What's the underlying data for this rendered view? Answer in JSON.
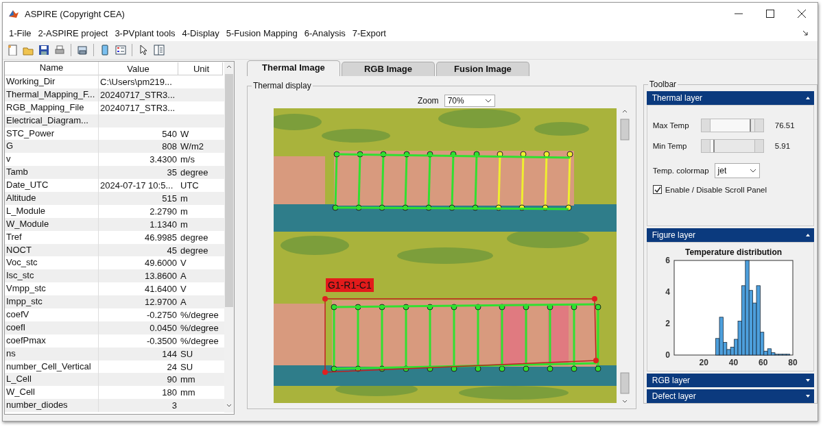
{
  "window": {
    "title": "ASPIRE (Copyright CEA)"
  },
  "menu": [
    "1-File",
    "2-ASPIRE project",
    "3-PVplant tools",
    "4-Display",
    "5-Fusion Mapping",
    "6-Analysis",
    "7-Export"
  ],
  "table": {
    "columns": [
      "Name",
      "Value",
      "Unit"
    ],
    "rows": [
      {
        "name": "Working_Dir",
        "value": "C:\\Users\\pm219...",
        "unit": "",
        "kind": "text"
      },
      {
        "name": "Thermal_Mapping_F...",
        "value": "20240717_STR3...",
        "unit": "",
        "kind": "text"
      },
      {
        "name": "RGB_Mapping_File",
        "value": "20240717_STR3...",
        "unit": "",
        "kind": "text"
      },
      {
        "name": "Electrical_Diagram...",
        "value": "",
        "unit": "",
        "kind": "text"
      },
      {
        "name": "STC_Power",
        "value": "540",
        "unit": "W",
        "kind": "number"
      },
      {
        "name": "G",
        "value": "808",
        "unit": "W/m2",
        "kind": "number"
      },
      {
        "name": "v",
        "value": "3.4300",
        "unit": "m/s",
        "kind": "number"
      },
      {
        "name": "Tamb",
        "value": "35",
        "unit": "degree",
        "kind": "number"
      },
      {
        "name": "Date_UTC",
        "value": "2024-07-17 10:5...",
        "unit": "UTC",
        "kind": "text"
      },
      {
        "name": "Altitude",
        "value": "515",
        "unit": "m",
        "kind": "number"
      },
      {
        "name": "L_Module",
        "value": "2.2790",
        "unit": "m",
        "kind": "number"
      },
      {
        "name": "W_Module",
        "value": "1.1340",
        "unit": "m",
        "kind": "number"
      },
      {
        "name": "Tref",
        "value": "46.9985",
        "unit": "degree",
        "kind": "number"
      },
      {
        "name": "NOCT",
        "value": "45",
        "unit": "degree",
        "kind": "number"
      },
      {
        "name": "Voc_stc",
        "value": "49.6000",
        "unit": "V",
        "kind": "number"
      },
      {
        "name": "Isc_stc",
        "value": "13.8600",
        "unit": "A",
        "kind": "number"
      },
      {
        "name": "Vmpp_stc",
        "value": "41.6400",
        "unit": "V",
        "kind": "number"
      },
      {
        "name": "Impp_stc",
        "value": "12.9700",
        "unit": "A",
        "kind": "number"
      },
      {
        "name": "coefV",
        "value": "-0.2750",
        "unit": "%/degree",
        "kind": "number"
      },
      {
        "name": "coefI",
        "value": "0.0450",
        "unit": "%/degree",
        "kind": "number"
      },
      {
        "name": "coefPmax",
        "value": "-0.3500",
        "unit": "%/degree",
        "kind": "number"
      },
      {
        "name": "ns",
        "value": "144",
        "unit": "SU",
        "kind": "number"
      },
      {
        "name": "number_Cell_Vertical",
        "value": "24",
        "unit": "SU",
        "kind": "number"
      },
      {
        "name": "L_Cell",
        "value": "90",
        "unit": "mm",
        "kind": "number"
      },
      {
        "name": "W_Cell",
        "value": "180",
        "unit": "mm",
        "kind": "number"
      },
      {
        "name": "number_diodes",
        "value": "3",
        "unit": "",
        "kind": "number"
      }
    ]
  },
  "tabs": [
    {
      "label": "Thermal Image",
      "selected": true
    },
    {
      "label": "RGB Image",
      "selected": false
    },
    {
      "label": "Fusion Image",
      "selected": false
    }
  ],
  "thermal_display": {
    "title": "Thermal display",
    "zoom_label": "Zoom",
    "zoom_value": "70%",
    "grid_label": "G1-R1-C1"
  },
  "toolbar": {
    "title": "Toolbar",
    "sections": [
      {
        "title": "Thermal layer",
        "expanded": true,
        "kind": "thermal",
        "sliders": [
          {
            "label": "Max Temp",
            "level": 0.93,
            "reading": "76.51"
          },
          {
            "label": "Min Temp",
            "level": 0.1,
            "reading": "5.91"
          }
        ],
        "colormap_label": "Temp. colormap",
        "colormap": "jet",
        "checkbox": {
          "label": "Enable / Disable Scroll Panel",
          "checked": true
        }
      },
      {
        "title": "Figure layer",
        "expanded": true,
        "kind": "figure",
        "chart_data": {
          "type": "bar",
          "title": "Temperature distribution",
          "x": [
            29.25,
            31.75,
            34.25,
            36.75,
            39.25,
            41.75,
            44.25,
            46.75,
            49.25,
            51.75,
            54.25,
            56.75,
            59.25,
            61.75,
            64.25,
            66.75,
            69.25,
            71.75,
            74.25,
            76.75
          ],
          "values": [
            1.05,
            2.4,
            0.8,
            0.35,
            0.5,
            1.0,
            2.15,
            4.4,
            6.0,
            4.1,
            3.3,
            4.4,
            1.45,
            0.25,
            0.4,
            0.15,
            0.05,
            0.05,
            0.05,
            0.05
          ],
          "xlim": [
            0,
            80
          ],
          "ylim": [
            0,
            6
          ],
          "xticks": [
            20,
            40,
            60,
            80
          ],
          "yticks": [
            0,
            2,
            4,
            6
          ]
        }
      },
      {
        "title": "RGB layer",
        "expanded": false,
        "kind": "plain"
      },
      {
        "title": "Defect layer",
        "expanded": false,
        "kind": "plain"
      }
    ]
  }
}
